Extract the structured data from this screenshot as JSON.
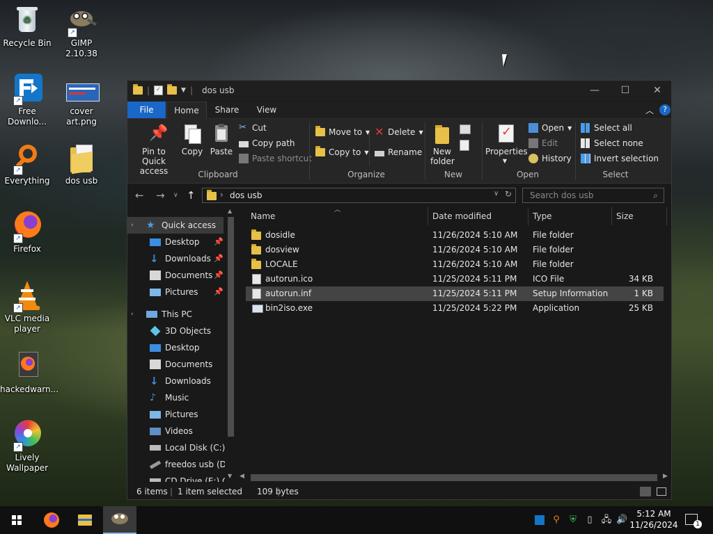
{
  "desktop": {
    "icons": [
      {
        "label": "Recycle Bin",
        "icon": "recycle-bin-icon"
      },
      {
        "label": "GIMP 2.10.38",
        "icon": "gimp-icon"
      },
      {
        "label": "Free Downlo...",
        "icon": "free-download-manager-icon"
      },
      {
        "label": "cover art.png",
        "icon": "image-file-icon"
      },
      {
        "label": "Everything",
        "icon": "everything-search-icon"
      },
      {
        "label": "dos usb",
        "icon": "folder-icon"
      },
      {
        "label": "Firefox",
        "icon": "firefox-icon"
      },
      {
        "label": "VLC media player",
        "icon": "vlc-icon"
      },
      {
        "label": "hackedwarn...",
        "icon": "firefox-document-icon"
      },
      {
        "label": "Lively Wallpaper",
        "icon": "lively-wallpaper-icon"
      }
    ]
  },
  "window": {
    "title": "dos usb",
    "controls": {
      "minimize": "—",
      "maximize": "☐",
      "close": "✕"
    },
    "ribbon_tabs": [
      "File",
      "Home",
      "Share",
      "View"
    ],
    "ribbon": {
      "clipboard": {
        "label": "Clipboard",
        "pin": "Pin to Quick access",
        "copy": "Copy",
        "paste": "Paste",
        "cut": "Cut",
        "copy_path": "Copy path",
        "paste_shortcut": "Paste shortcut"
      },
      "organize": {
        "label": "Organize",
        "move_to": "Move to",
        "copy_to": "Copy to",
        "delete": "Delete",
        "rename": "Rename"
      },
      "new": {
        "label": "New",
        "new_folder": "New folder"
      },
      "open": {
        "label": "Open",
        "properties": "Properties",
        "open": "Open",
        "edit": "Edit",
        "history": "History"
      },
      "select": {
        "label": "Select",
        "select_all": "Select all",
        "select_none": "Select none",
        "invert": "Invert selection"
      }
    },
    "address": {
      "path": "dos usb",
      "search_placeholder": "Search dos usb"
    },
    "nav": {
      "quick_access": "Quick access",
      "quick_items": [
        "Desktop",
        "Downloads",
        "Documents",
        "Pictures"
      ],
      "this_pc": "This PC",
      "pc_items": [
        "3D Objects",
        "Desktop",
        "Documents",
        "Downloads",
        "Music",
        "Pictures",
        "Videos",
        "Local Disk (C:)",
        "freedos usb (D:)",
        "CD Drive (E:) GP..."
      ]
    },
    "columns": {
      "name": "Name",
      "date": "Date modified",
      "type": "Type",
      "size": "Size"
    },
    "files": [
      {
        "name": "dosidle",
        "date": "11/26/2024 5:10 AM",
        "type": "File folder",
        "size": "",
        "icon": "folder-icon"
      },
      {
        "name": "dosview",
        "date": "11/26/2024 5:10 AM",
        "type": "File folder",
        "size": "",
        "icon": "folder-icon"
      },
      {
        "name": "LOCALE",
        "date": "11/26/2024 5:10 AM",
        "type": "File folder",
        "size": "",
        "icon": "folder-icon"
      },
      {
        "name": "autorun.ico",
        "date": "11/25/2024 5:11 PM",
        "type": "ICO File",
        "size": "34 KB",
        "icon": "ico-file-icon"
      },
      {
        "name": "autorun.inf",
        "date": "11/25/2024 5:11 PM",
        "type": "Setup Information",
        "size": "1 KB",
        "icon": "inf-file-icon"
      },
      {
        "name": "bin2iso.exe",
        "date": "11/25/2024 5:22 PM",
        "type": "Application",
        "size": "25 KB",
        "icon": "exe-file-icon"
      }
    ],
    "status": {
      "items": "6 items",
      "selected": "1 item selected",
      "bytes": "109 bytes"
    }
  },
  "taskbar": {
    "apps": [
      "start-icon",
      "firefox-icon",
      "file-explorer-icon",
      "gimp-icon"
    ],
    "clock": {
      "time": "5:12 AM",
      "date": "11/26/2024"
    },
    "notifications": "1"
  },
  "colors": {
    "accent": "#1a67c7",
    "folder": "#e8c049",
    "selected_row": "#444444"
  }
}
